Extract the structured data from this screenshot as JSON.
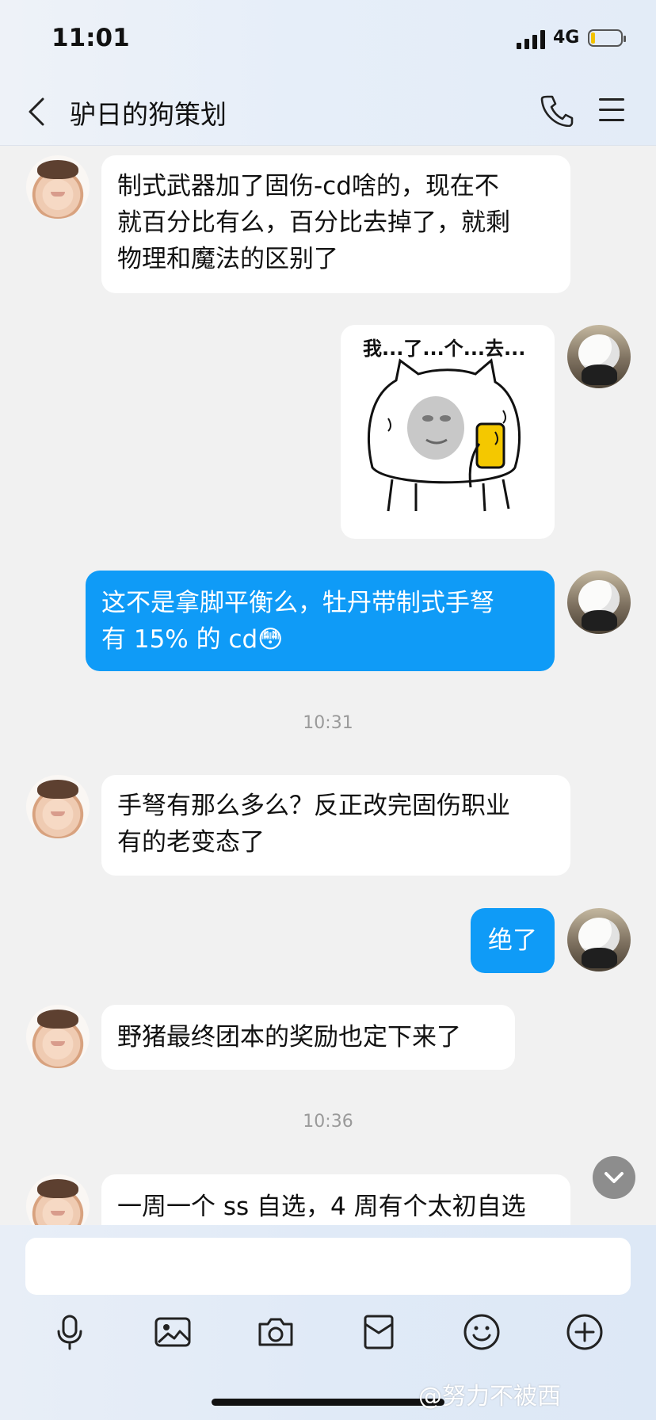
{
  "status_bar": {
    "time": "11:01",
    "network": "4G"
  },
  "header": {
    "title": "驴日的狗策划"
  },
  "messages": [
    {
      "sender": "other",
      "text": "制式武器加了固伤-cd啥的，现在不\n就百分比有么，百分比去掉了，就剩\n物理和魔法的区别了"
    },
    {
      "sender": "self",
      "type": "sticker",
      "sticker_text": "我...了...个...去..."
    },
    {
      "sender": "self",
      "text": "这不是拿脚平衡么，牡丹带制式手弩\n有 15% 的 cd😳"
    },
    {
      "time": "10:31"
    },
    {
      "sender": "other",
      "text": "手弩有那么多么？反正改完固伤职业\n有的老变态了"
    },
    {
      "sender": "self",
      "text": "绝了"
    },
    {
      "sender": "other",
      "text": "野猪最终团本的奖励也定下来了"
    },
    {
      "time": "10:36"
    },
    {
      "sender": "other",
      "text": "一周一个 ss 自选，4 周有个太初自选"
    }
  ],
  "toolbar": [
    "microphone-icon",
    "image-icon",
    "camera-icon",
    "red-packet-icon",
    "emoji-icon",
    "plus-icon"
  ],
  "watermark": "@努力不被西",
  "colors": {
    "outgoing_bubble": "#0f9bf7",
    "background": "#f1f1f1"
  }
}
